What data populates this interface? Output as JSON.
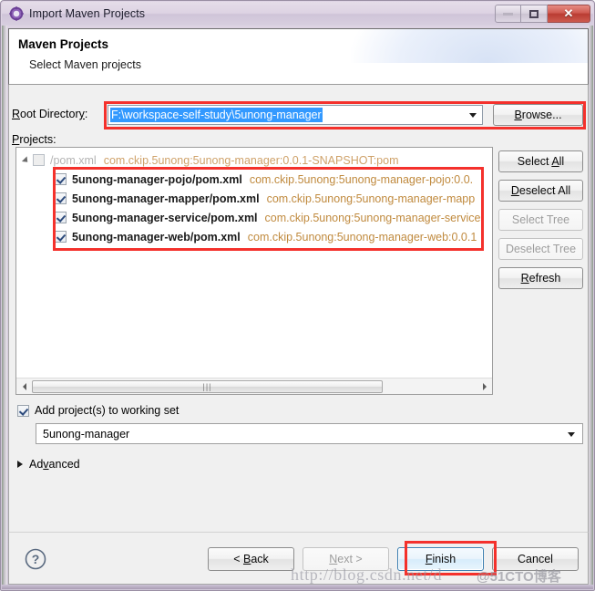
{
  "window": {
    "title": "Import Maven Projects",
    "icon": "maven-gear-icon",
    "controls": {
      "minimize": "minimize-icon",
      "maximize": "restore-icon",
      "close": "✕"
    }
  },
  "header": {
    "title": "Maven Projects",
    "subtitle": "Select Maven projects"
  },
  "root_directory": {
    "label": "Root Directory:",
    "value": "F:\\workspace-self-study\\5unong-manager",
    "selected": true,
    "browse_label": "Browse..."
  },
  "projects": {
    "label": "Projects:",
    "rows": [
      {
        "name": "/pom.xml",
        "coordinates": "com.ckip.5unong:5unong-manager:0.0.1-SNAPSHOT:pom",
        "checked": false,
        "enabled": false,
        "indent": 0,
        "expander": true
      },
      {
        "name": "5unong-manager-pojo/pom.xml",
        "coordinates": "com.ckip.5unong:5unong-manager-pojo:0.0.",
        "checked": true,
        "enabled": true,
        "indent": 1,
        "expander": false
      },
      {
        "name": "5unong-manager-mapper/pom.xml",
        "coordinates": "com.ckip.5unong:5unong-manager-mapp",
        "checked": true,
        "enabled": true,
        "indent": 1,
        "expander": false
      },
      {
        "name": "5unong-manager-service/pom.xml",
        "coordinates": "com.ckip.5unong:5unong-manager-service",
        "checked": true,
        "enabled": true,
        "indent": 1,
        "expander": false
      },
      {
        "name": "5unong-manager-web/pom.xml",
        "coordinates": "com.ckip.5unong:5unong-manager-web:0.0.1",
        "checked": true,
        "enabled": true,
        "indent": 1,
        "expander": false
      }
    ],
    "scrollbar": {
      "left_arrow": "scroll-left-icon",
      "right_arrow": "scroll-right-icon",
      "grip": "|||"
    }
  },
  "side_buttons": [
    {
      "label": "Select All",
      "enabled": true
    },
    {
      "label": "Deselect All",
      "enabled": true
    },
    {
      "label": "Select Tree",
      "enabled": false
    },
    {
      "label": "Deselect Tree",
      "enabled": false
    },
    {
      "label": "Refresh",
      "enabled": true
    }
  ],
  "working_set": {
    "checkbox_label": "Add project(s) to working set",
    "checked": true,
    "value": "5unong-manager"
  },
  "advanced": {
    "label": "Advanced",
    "expanded": false
  },
  "button_bar": {
    "help": "help-icon",
    "buttons": [
      {
        "label": "< Back",
        "enabled": true,
        "default": false
      },
      {
        "label": "Next >",
        "enabled": false,
        "default": false
      },
      {
        "label": "Finish",
        "enabled": true,
        "default": true
      },
      {
        "label": "Cancel",
        "enabled": true,
        "default": false
      }
    ]
  },
  "watermark": {
    "url": "http://blog.csdn.net/d",
    "site": "@51CTO博客"
  },
  "colors": {
    "accent_blue": "#3399ff",
    "annotation_red": "#f4312c",
    "coordinate_orange": "#c08a3e",
    "close_red": "#b93c32"
  }
}
